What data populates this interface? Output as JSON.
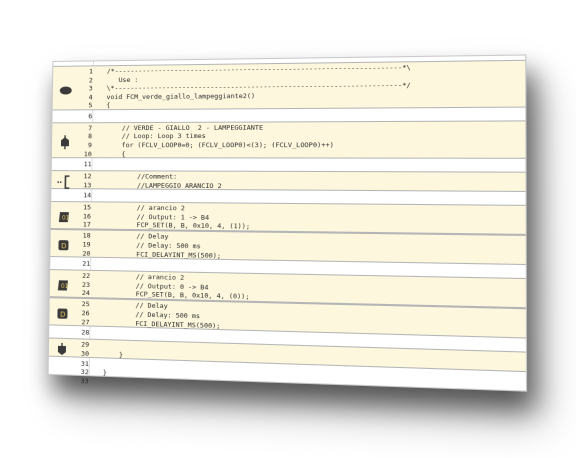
{
  "blocks": [
    {
      "icon": "ellipse-icon",
      "filled": true,
      "lines": [
        {
          "n": "1",
          "code": "/*----------------------------------------------------------------------*\\"
        },
        {
          "n": "2",
          "code": "   Use :"
        },
        {
          "n": "3",
          "code": "\\*----------------------------------------------------------------------*/"
        },
        {
          "n": "4",
          "code": "void FCM_verde_giallo_lampeggiante2()"
        },
        {
          "n": "5",
          "code": "{"
        }
      ]
    },
    {
      "icon": "none",
      "filled": false,
      "lines": [
        {
          "n": "6",
          "code": ""
        }
      ]
    },
    {
      "icon": "loop-icon",
      "filled": true,
      "lines": [
        {
          "n": "7",
          "code": "    // VERDE - GIALLO  2 - LAMPEGGIANTE"
        },
        {
          "n": "8",
          "code": "    // Loop: Loop 3 times"
        },
        {
          "n": "9",
          "code": "    for (FCLV_LOOP0=0; (FCLV_LOOP0)<(3); (FCLV_LOOP0)++)"
        },
        {
          "n": "10",
          "code": "    {"
        }
      ]
    },
    {
      "icon": "none",
      "filled": false,
      "lines": [
        {
          "n": "11",
          "code": ""
        }
      ]
    },
    {
      "icon": "comment-icon",
      "filled": true,
      "lines": [
        {
          "n": "12",
          "code": "        //Comment:"
        },
        {
          "n": "13",
          "code": "        //LAMPEGGIO ARANCIO 2"
        }
      ]
    },
    {
      "icon": "none",
      "filled": false,
      "lines": [
        {
          "n": "14",
          "code": ""
        }
      ]
    },
    {
      "icon": "output-icon",
      "filled": true,
      "lines": [
        {
          "n": "15",
          "code": "        // arancio 2"
        },
        {
          "n": "16",
          "code": "        // Output: 1 -> B4"
        },
        {
          "n": "17",
          "code": "        FCP_SET(B, B, 0x10, 4, (1));"
        }
      ]
    },
    {
      "icon": "delay-icon",
      "filled": true,
      "lines": [
        {
          "n": "18",
          "code": "        // Delay"
        },
        {
          "n": "19",
          "code": "        // Delay: 500 ms"
        },
        {
          "n": "20",
          "code": "        FCI_DELAYINT_MS(500);"
        }
      ]
    },
    {
      "icon": "none",
      "filled": false,
      "lines": [
        {
          "n": "21",
          "code": ""
        }
      ]
    },
    {
      "icon": "output-icon",
      "filled": true,
      "lines": [
        {
          "n": "22",
          "code": "        // arancio 2"
        },
        {
          "n": "23",
          "code": "        // Output: 0 -> B4"
        },
        {
          "n": "24",
          "code": "        FCP_SET(B, B, 0x10, 4, (0));"
        }
      ]
    },
    {
      "icon": "delay-icon",
      "filled": true,
      "lines": [
        {
          "n": "25",
          "code": "        // Delay"
        },
        {
          "n": "26",
          "code": "        // Delay: 500 ms"
        },
        {
          "n": "27",
          "code": "        FCI_DELAYINT_MS(500);"
        }
      ]
    },
    {
      "icon": "none",
      "filled": false,
      "lines": [
        {
          "n": "28",
          "code": ""
        }
      ]
    },
    {
      "icon": "loop-end-icon",
      "filled": true,
      "lines": [
        {
          "n": "29",
          "code": ""
        },
        {
          "n": "30",
          "code": "    }"
        }
      ]
    },
    {
      "icon": "none",
      "filled": false,
      "lines": [
        {
          "n": "31",
          "code": ""
        },
        {
          "n": "32",
          "code": "}"
        },
        {
          "n": "33",
          "code": ""
        }
      ]
    }
  ],
  "colors": {
    "block_fill": "#fdf8dd",
    "icon_fill": "#3a3a3a",
    "border": "#b5b5b5"
  }
}
